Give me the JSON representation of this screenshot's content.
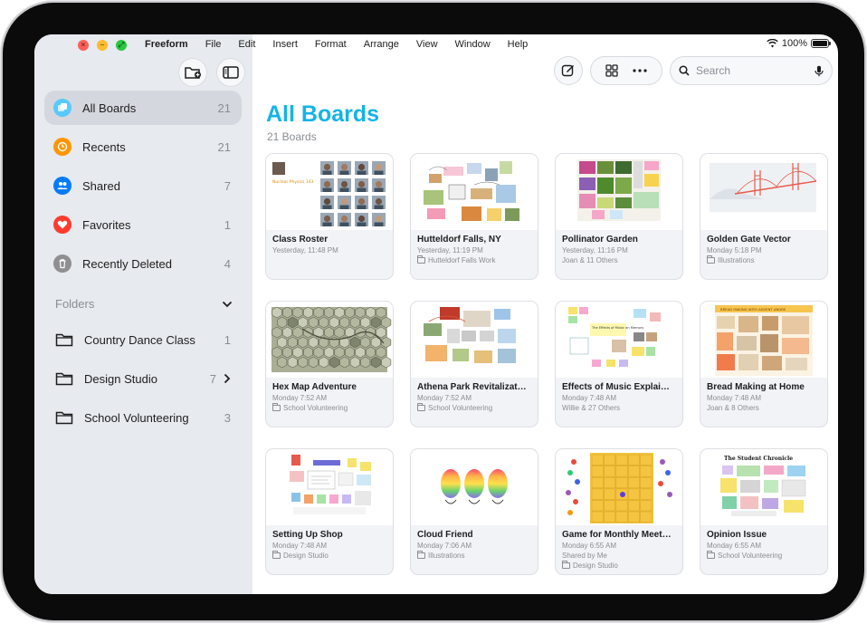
{
  "menubar": {
    "app_name": "Freeform",
    "menus": [
      "File",
      "Edit",
      "Insert",
      "Format",
      "Arrange",
      "View",
      "Window",
      "Help"
    ],
    "battery": "100%"
  },
  "sidebar": {
    "items": [
      {
        "label": "All Boards",
        "count": "21",
        "icon": "all-boards-icon",
        "color": "#5ac8fa"
      },
      {
        "label": "Recents",
        "count": "21",
        "icon": "clock-icon",
        "color": "#ff9500"
      },
      {
        "label": "Shared",
        "count": "7",
        "icon": "people-icon",
        "color": "#007aff"
      },
      {
        "label": "Favorites",
        "count": "1",
        "icon": "heart-icon",
        "color": "#ff3b30"
      },
      {
        "label": "Recently Deleted",
        "count": "4",
        "icon": "trash-icon",
        "color": "#8e8e93"
      }
    ],
    "folders_header": "Folders",
    "folders": [
      {
        "label": "Country Dance Class",
        "count": "1"
      },
      {
        "label": "Design Studio",
        "count": "7"
      },
      {
        "label": "School Volunteering",
        "count": "3"
      }
    ]
  },
  "search": {
    "placeholder": "Search"
  },
  "main": {
    "title": "All Boards",
    "subtitle": "21 Boards",
    "accent": "#14b4e6",
    "boards": [
      {
        "title": "Class Roster",
        "date": "Yesterday, 11:48 PM",
        "sub": "",
        "folder": false
      },
      {
        "title": "Hutteldorf Falls, NY",
        "date": "Yesterday, 11:19 PM",
        "sub": "Hutteldorf Falls Work",
        "folder": true
      },
      {
        "title": "Pollinator Garden",
        "date": "Yesterday, 11:16 PM",
        "sub": "Joan & 11 Others",
        "folder": false
      },
      {
        "title": "Golden Gate Vector",
        "date": "Monday 5:18 PM",
        "sub": "Illustrations",
        "folder": true
      },
      {
        "title": "Hex Map Adventure",
        "date": "Monday 7:52 AM",
        "sub": "School Volunteering",
        "folder": true
      },
      {
        "title": "Athena Park Revitalizat…",
        "date": "Monday 7:52 AM",
        "sub": "School Volunteering",
        "folder": true
      },
      {
        "title": "Effects of Music Explai…",
        "date": "Monday 7:48 AM",
        "sub": "Willie & 27 Others",
        "folder": false
      },
      {
        "title": "Bread Making at Home",
        "date": "Monday 7:48 AM",
        "sub": "Joan & 8 Others",
        "folder": false
      },
      {
        "title": "Setting Up Shop",
        "date": "Monday 7:48 AM",
        "sub": "Design Studio",
        "folder": true
      },
      {
        "title": "Cloud Friend",
        "date": "Monday 7:06 AM",
        "sub": "Illustrations",
        "folder": true
      },
      {
        "title": "Game for Monthly Meet…",
        "date": "Monday 6:55 AM",
        "sub": "Shared by Me",
        "sub2": "Design Studio",
        "folder": true
      },
      {
        "title": "Opinion Issue",
        "date": "Monday 6:55 AM",
        "sub": "School Volunteering",
        "folder": true
      }
    ]
  },
  "thumb_text": {
    "class_roster": "Nuclear Physics 143",
    "student_chronicle": "The Student Chronicle",
    "music_title": "The Effects of Music on Memory",
    "bread_title": "BREAD MAKING WITH ADVENT ANGRE"
  }
}
